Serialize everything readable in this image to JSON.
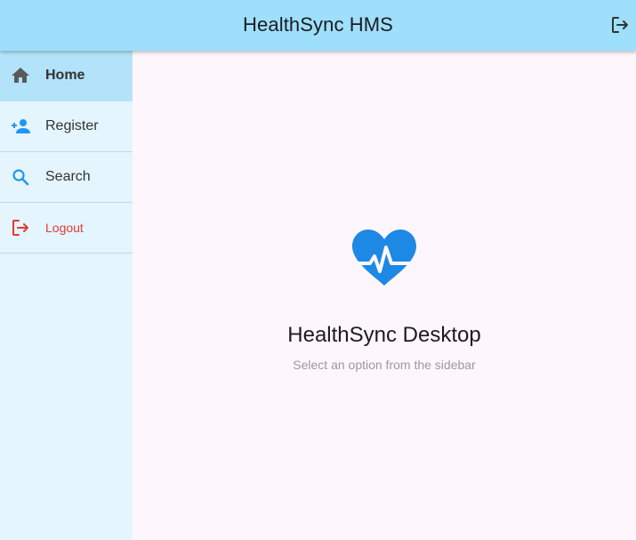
{
  "header": {
    "title": "HealthSync HMS",
    "logout_icon": "logout-icon",
    "background": "#9edffb"
  },
  "sidebar": {
    "background": "#e4f5fd",
    "active_background": "#b3e3fa",
    "items": [
      {
        "label": "Home",
        "icon": "home-icon",
        "active": true
      },
      {
        "label": "Register",
        "icon": "person-add-icon",
        "active": false
      },
      {
        "label": "Search",
        "icon": "search-icon",
        "active": false
      },
      {
        "label": "Logout",
        "icon": "logout-icon",
        "active": false,
        "color": "#e53935"
      }
    ]
  },
  "main": {
    "icon": "heart-pulse-icon",
    "icon_color": "#1e88e5",
    "title": "HealthSync Desktop",
    "subtitle": "Select an option from the sidebar"
  }
}
